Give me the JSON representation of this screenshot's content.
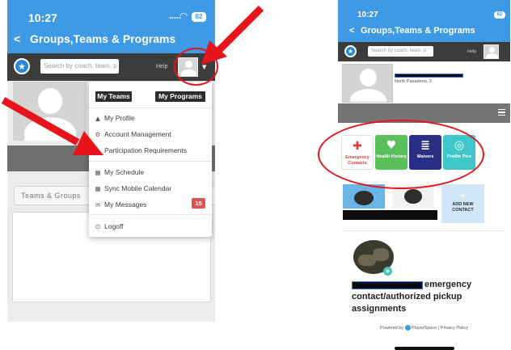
{
  "left": {
    "status": {
      "time": "10:27",
      "signal": "‥…",
      "wifi": "◠",
      "battery": "82"
    },
    "nav": {
      "back": "<",
      "title": "Groups,Teams & Programs"
    },
    "toolbar": {
      "logo": "★",
      "search_placeholder": "Search by coach, team, p",
      "help": "Help",
      "caret": "▼"
    },
    "dropdown": {
      "my_teams": "My Teams",
      "my_programs": "My Programs",
      "items": [
        {
          "icon": "▲",
          "label": "My Profile"
        },
        {
          "icon": "⚙",
          "label": "Account Management"
        },
        {
          "icon": "ℹ",
          "label": "Participation Requirements"
        },
        {
          "icon": "▦",
          "label": "My Schedule"
        },
        {
          "icon": "▦",
          "label": "Sync Mobile Calendar"
        },
        {
          "icon": "✉",
          "label": "My Messages"
        },
        {
          "icon": "⏻",
          "label": "Logoff"
        }
      ],
      "messages_badge": "15"
    },
    "tabs": {
      "teams_groups": "Teams & Groups"
    }
  },
  "right": {
    "status": {
      "time": "10:27",
      "battery": "82"
    },
    "nav": {
      "back": "<",
      "title": "Groups,Teams & Programs"
    },
    "toolbar": {
      "logo": "★",
      "search_placeholder": "Search by coach, team, p",
      "help": "Help"
    },
    "profile_sub": "North Pasadena, 3",
    "tiles": [
      {
        "label": "Emergency Contacts",
        "icon": "✚",
        "color": "#ffffff",
        "text_color": "#e53935"
      },
      {
        "label": "Health History",
        "icon": "♥",
        "color": "#5ac05c",
        "text_color": "#ffffff"
      },
      {
        "label": "Waivers",
        "icon": "≣",
        "color": "#2a2f86",
        "text_color": "#ffffff"
      },
      {
        "label": "Profile Pics",
        "icon": "◎",
        "color": "#3fc6c8",
        "text_color": "#ffffff"
      }
    ],
    "add_contact": {
      "plus": "+",
      "label": "ADD NEW CONTACT"
    },
    "card": {
      "title_line1": "emergency",
      "title_line2": "contact/authorized pickup",
      "title_line3": "assignments"
    },
    "footer": {
      "powered": "Powered by",
      "brand": "PlayerSpace",
      "privacy": "| Privacy Policy"
    }
  },
  "colors": {
    "header_blue": "#3f9ae6",
    "toolbar_dark": "#3c3c3c",
    "annotation_red": "#e8141c",
    "badge_red": "#d9534f"
  }
}
